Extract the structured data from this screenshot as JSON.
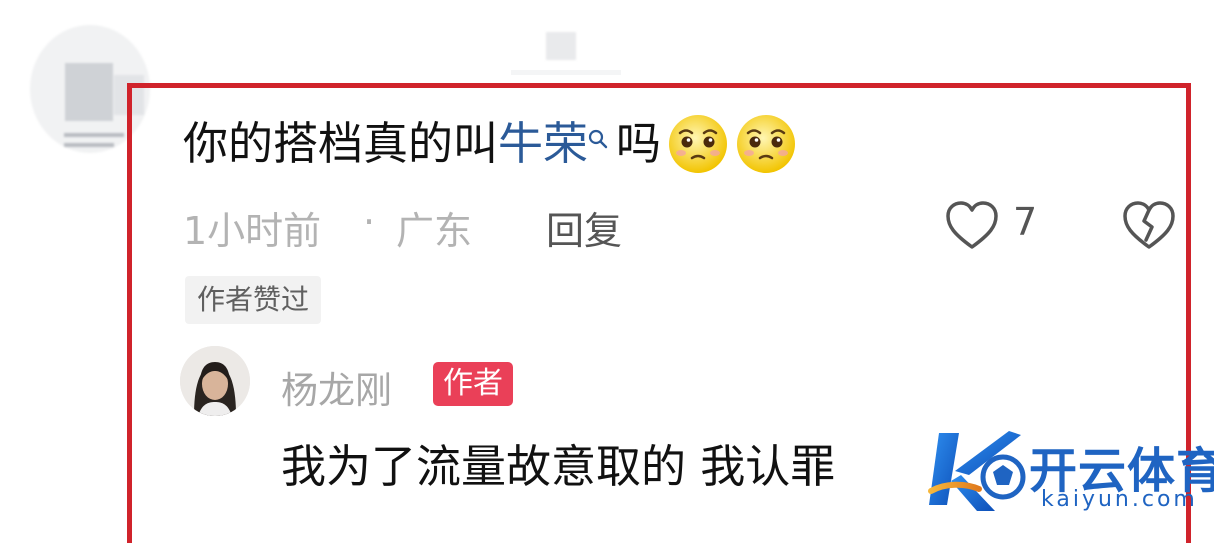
{
  "comment": {
    "text_before": "你的搭档真的叫",
    "link_text": "牛荣",
    "text_after": "吗",
    "emojis": [
      "pleading-face-icon",
      "pleading-face-icon"
    ]
  },
  "meta": {
    "time": "1小时前",
    "separator": "·",
    "location": "广东",
    "reply_label": "回复",
    "like_count": "7"
  },
  "liked_badge": "作者赞过",
  "author_reply": {
    "name": "杨龙刚",
    "tag": "作者",
    "text": "我为了流量故意取的 我认罪"
  },
  "watermark": {
    "cn": "开云体育",
    "en": "kaiyun.com"
  },
  "colors": {
    "frame": "#d0232b",
    "link": "#2b5a98",
    "author_tag": "#ea4058",
    "watermark": "#1f64c2"
  }
}
